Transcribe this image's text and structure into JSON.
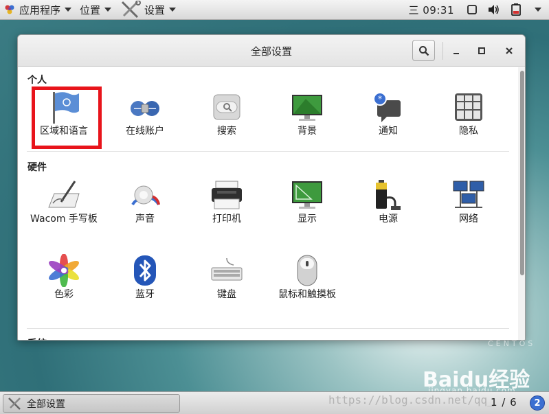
{
  "top_panel": {
    "applications_label": "应用程序",
    "places_label": "位置",
    "settings_label": "设置",
    "clock": "三 09:31"
  },
  "window": {
    "title": "全部设置",
    "sections": [
      {
        "title": "个人",
        "items": [
          {
            "label": "区域和语言",
            "icon": "flag-icon"
          },
          {
            "label": "在线账户",
            "icon": "online-accounts-icon"
          },
          {
            "label": "搜索",
            "icon": "search-settings-icon"
          },
          {
            "label": "背景",
            "icon": "background-icon"
          },
          {
            "label": "通知",
            "icon": "notification-icon"
          },
          {
            "label": "隐私",
            "icon": "privacy-lock-icon"
          }
        ]
      },
      {
        "title": "硬件",
        "items": [
          {
            "label": "Wacom 手写板",
            "icon": "wacom-tablet-icon"
          },
          {
            "label": "声音",
            "icon": "sound-knob-icon"
          },
          {
            "label": "打印机",
            "icon": "printer-icon"
          },
          {
            "label": "显示",
            "icon": "display-icon"
          },
          {
            "label": "电源",
            "icon": "power-battery-icon"
          },
          {
            "label": "网络",
            "icon": "network-icon"
          },
          {
            "label": "色彩",
            "icon": "color-icon"
          },
          {
            "label": "蓝牙",
            "icon": "bluetooth-icon"
          },
          {
            "label": "键盘",
            "icon": "keyboard-icon"
          },
          {
            "label": "鼠标和触摸板",
            "icon": "mouse-icon"
          }
        ]
      },
      {
        "title": "系统"
      }
    ]
  },
  "bottom_panel": {
    "task_label": "全部设置",
    "workspace_pager": "1 / 6",
    "notification_count": "2"
  },
  "watermark": {
    "centos_text": "CENTOS",
    "baidu_text": "Baidu经验",
    "jingyan_text": "jingyan.baidu.com",
    "url_text": "https://blog.csdn.net/qq_"
  },
  "colors": {
    "highlight": "#e8141b",
    "badge": "#3b6fd1"
  }
}
